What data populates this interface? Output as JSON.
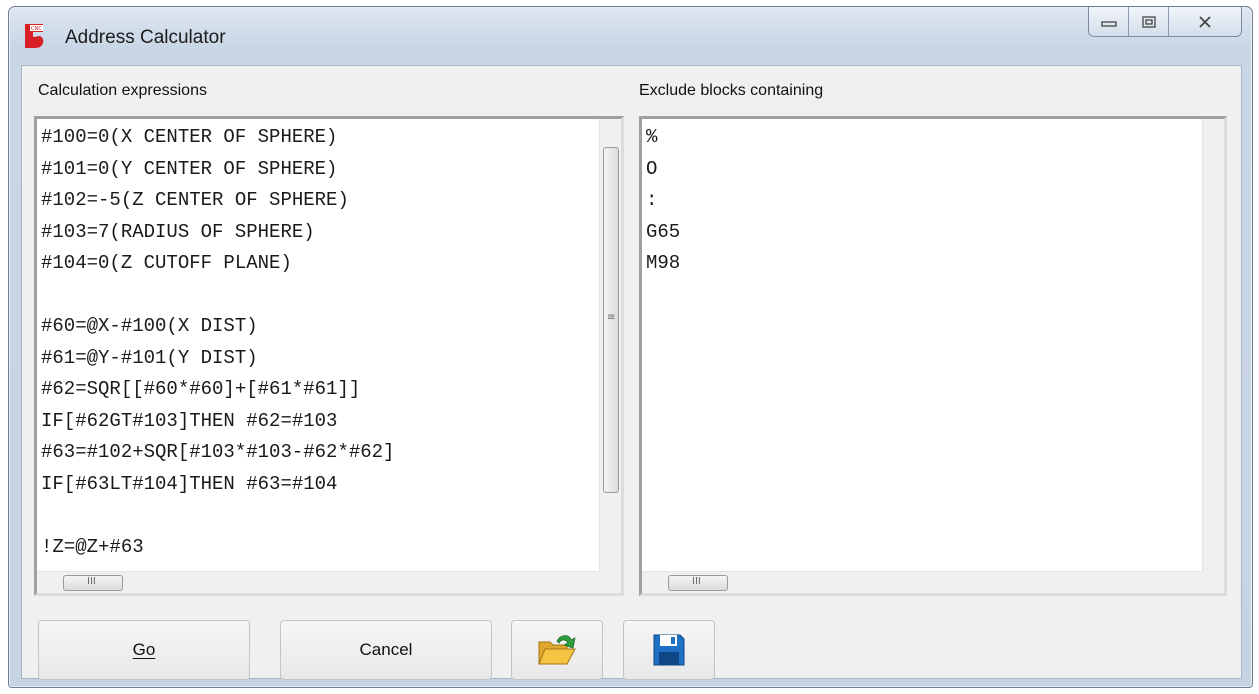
{
  "window": {
    "title": "Address Calculator",
    "app_icon": "cnc-logo-icon",
    "caption_buttons": [
      "minimize-icon",
      "maximize-icon",
      "close-icon"
    ]
  },
  "left_panel": {
    "label": "Calculation expressions",
    "lines": [
      "#100=0(X CENTER OF SPHERE)",
      "#101=0(Y CENTER OF SPHERE)",
      "#102=-5(Z CENTER OF SPHERE)",
      "#103=7(RADIUS OF SPHERE)",
      "#104=0(Z CUTOFF PLANE)",
      "",
      "#60=@X-#100(X DIST)",
      "#61=@Y-#101(Y DIST)",
      "#62=SQR[[#60*#60]+[#61*#61]]",
      "IF[#62GT#103]THEN #62=#103",
      "#63=#102+SQR[#103*#103-#62*#62]",
      "IF[#63LT#104]THEN #63=#104",
      "",
      "!Z=@Z+#63"
    ]
  },
  "right_panel": {
    "label": "Exclude blocks containing",
    "lines": [
      "%",
      "O",
      ":",
      "G65",
      "M98"
    ]
  },
  "buttons": {
    "go_label": "Go",
    "cancel_label": "Cancel",
    "open_icon": "open-folder-icon",
    "save_icon": "floppy-save-icon"
  },
  "colors": {
    "title_bar": "#c9d6e6",
    "client_bg": "#f0f0f0",
    "logo_red": "#d91f26",
    "folder_yellow": "#f4c542",
    "arrow_green": "#2e9c3a",
    "floppy_blue": "#1f6fc4"
  }
}
